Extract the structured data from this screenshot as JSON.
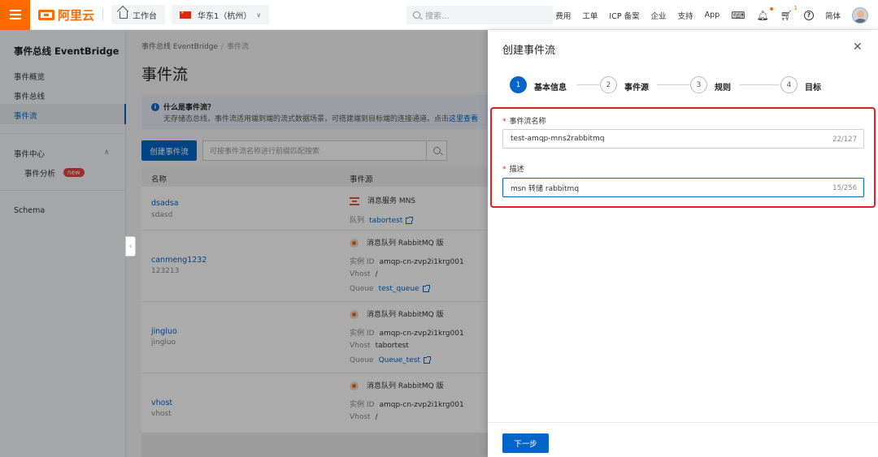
{
  "topbar": {
    "logo_text": "阿里云",
    "workbench": "工作台",
    "region": "华东1（杭州）",
    "search_placeholder": "搜索...",
    "links": [
      "费用",
      "工单",
      "ICP 备案",
      "企业",
      "支持",
      "App"
    ],
    "cart_badge": "1",
    "lang": "简体"
  },
  "sidebar": {
    "title": "事件总线 EventBridge",
    "items": [
      "事件概览",
      "事件总线",
      "事件流"
    ],
    "group": "事件中心",
    "sub_item": "事件分析",
    "new_badge": "new",
    "schema": "Schema"
  },
  "main": {
    "breadcrumb": [
      "事件总线 EventBridge",
      "事件流"
    ],
    "title": "事件流",
    "info_title": "什么是事件流？",
    "info_text": "无存储态总线，事件流适用端到端的流式数据场景，可搭建端到目标端的连接通道。点击",
    "info_link": "这里查看",
    "create_button": "创建事件流",
    "search_placeholder": "可按事件流名称进行前缀匹配搜索",
    "columns": [
      "名称",
      "事件源"
    ],
    "rows": [
      {
        "name": "dsadsa",
        "desc": "sdasd",
        "source": "消息服务 MNS",
        "lines": [
          {
            "k": "队列",
            "v": "tabortest",
            "link": true
          }
        ]
      },
      {
        "name": "canmeng1232",
        "desc": "123213",
        "source": "消息队列 RabbitMQ 版",
        "lines": [
          {
            "k": "实例 ID",
            "v": "amqp-cn-zvp2i1krg001",
            "link": false
          },
          {
            "k": "Vhost",
            "v": "/",
            "link": false
          },
          {
            "k": "Queue",
            "v": "test_queue",
            "link": true
          }
        ]
      },
      {
        "name": "jingluo",
        "desc": "jingluo",
        "source": "消息队列 RabbitMQ 版",
        "lines": [
          {
            "k": "实例 ID",
            "v": "amqp-cn-zvp2i1krg001",
            "link": false
          },
          {
            "k": "Vhost",
            "v": "tabortest",
            "link": false
          },
          {
            "k": "Queue",
            "v": "Queue_test",
            "link": true
          }
        ]
      },
      {
        "name": "vhost",
        "desc": "vhost",
        "source": "消息队列 RabbitMQ 版",
        "lines": [
          {
            "k": "实例 ID",
            "v": "amqp-cn-zvp2i1krg001",
            "link": false
          },
          {
            "k": "Vhost",
            "v": "/",
            "link": false
          }
        ]
      }
    ]
  },
  "drawer": {
    "title": "创建事件流",
    "steps": [
      {
        "num": "1",
        "label": "基本信息"
      },
      {
        "num": "2",
        "label": "事件源"
      },
      {
        "num": "3",
        "label": "规则"
      },
      {
        "num": "4",
        "label": "目标"
      }
    ],
    "name_label": "事件流名称",
    "name_value": "test-amqp-mns2rabbitmq",
    "name_count": "22/127",
    "desc_label": "描述",
    "desc_value": "msn 转储 rabbitmq",
    "desc_count": "15/256",
    "next_button": "下一步"
  }
}
